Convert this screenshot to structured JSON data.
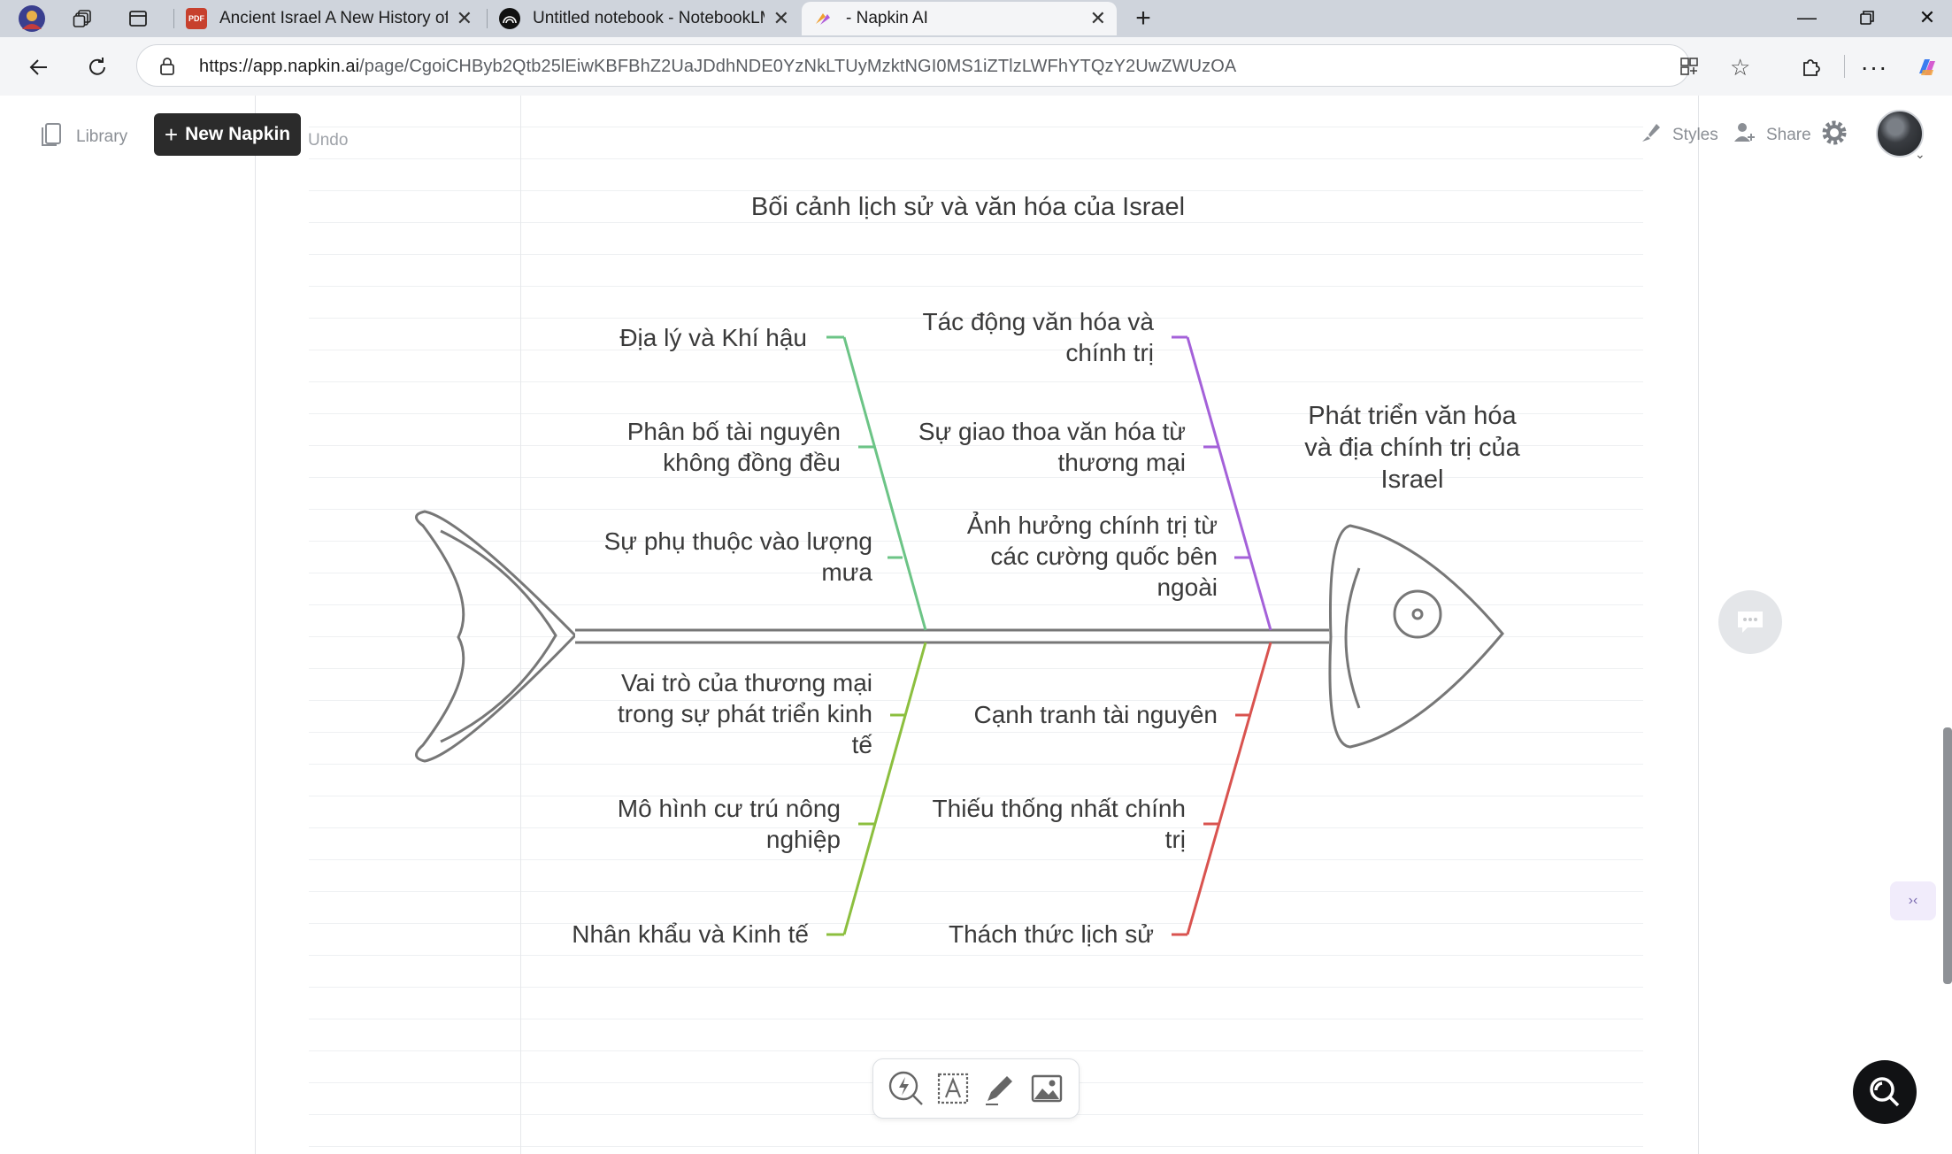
{
  "browser": {
    "tabs": [
      {
        "title": "Ancient Israel A New History of Is",
        "icon": "pdf-icon",
        "active": false
      },
      {
        "title": "Untitled notebook - NotebookLM",
        "icon": "notebooklm-icon",
        "active": false
      },
      {
        "title": "- Napkin AI",
        "icon": "napkin-icon",
        "active": true
      }
    ],
    "url_host": "https://app.napkin.ai",
    "url_path": "/page/CgoiCHByb2Qtb25lEiwKBFBhZ2UaJDdhNDE0YzNkLTUyMzktNGI0MS1iZTlzLWFhYTQzY2UwZWUzOA"
  },
  "app": {
    "library_label": "Library",
    "new_napkin_label": "New Napkin",
    "undo_label": "Undo",
    "styles_label": "Styles",
    "share_label": "Share"
  },
  "diagram": {
    "title": "Bối cảnh lịch sử và văn hóa của Israel",
    "effect": "Phát triển văn hóa\nvà địa chính trị của\nIsrael",
    "branches": [
      {
        "color": "#6cc486",
        "causes": [
          "Địa lý và Khí hậu",
          "Phân bố tài nguyên\nkhông đồng đều",
          "Sự phụ thuộc vào lượng\nmưa"
        ]
      },
      {
        "color": "#a461d9",
        "causes": [
          "Tác động văn hóa và\nchính trị",
          "Sự giao thoa văn hóa từ\nthương mại",
          "Ảnh hưởng chính trị từ\ncác cường quốc bên\nngoài"
        ]
      },
      {
        "color": "#8cbf3f",
        "causes": [
          "Vai trò của thương mại\ntrong sự phát triển kinh\ntế",
          "Mô hình cư trú nông\nnghiệp",
          "Nhân khẩu và Kinh tế"
        ]
      },
      {
        "color": "#d9534f",
        "causes": [
          "Cạnh tranh tài nguyên",
          "Thiếu thống nhất chính\ntrị",
          "Thách thức lịch sử"
        ]
      }
    ]
  }
}
